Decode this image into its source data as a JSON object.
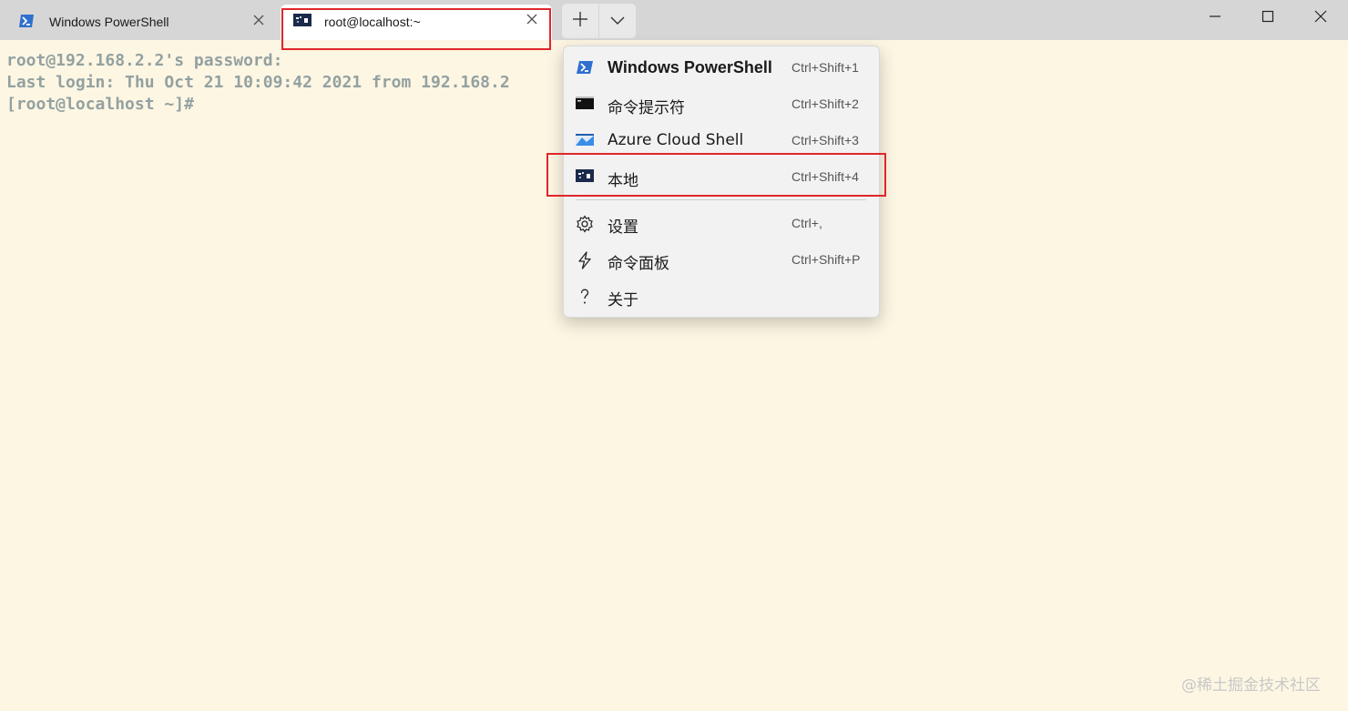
{
  "tabs": [
    {
      "title": "Windows PowerShell",
      "icon": "powershell-icon"
    },
    {
      "title": "root@localhost:~",
      "icon": "linux-terminal-icon",
      "active": true
    }
  ],
  "window_controls": {
    "minimize": "minimize-icon",
    "maximize": "maximize-icon",
    "close": "close-icon"
  },
  "terminal": {
    "lines": [
      "root@192.168.2.2's password:",
      "Last login: Thu Oct 21 10:09:42 2021 from 192.168.2",
      "[root@localhost ~]#"
    ],
    "background": "#fdf6e3",
    "foreground": "#93a1a1"
  },
  "menu": {
    "profiles": [
      {
        "label": "Windows PowerShell",
        "shortcut": "Ctrl+Shift+1",
        "icon": "powershell-icon"
      },
      {
        "label": "命令提示符",
        "shortcut": "Ctrl+Shift+2",
        "icon": "cmd-icon"
      },
      {
        "label": "Azure Cloud Shell",
        "shortcut": "Ctrl+Shift+3",
        "icon": "azure-cloud-icon"
      },
      {
        "label": "本地",
        "shortcut": "Ctrl+Shift+4",
        "icon": "linux-terminal-icon"
      }
    ],
    "actions": [
      {
        "label": "设置",
        "shortcut": "Ctrl+,",
        "icon": "gear-icon"
      },
      {
        "label": "命令面板",
        "shortcut": "Ctrl+Shift+P",
        "icon": "lightning-icon"
      },
      {
        "label": "关于",
        "shortcut": "",
        "icon": "question-icon"
      }
    ]
  },
  "highlight_color": "#e0262a",
  "watermark": "@稀土掘金技术社区"
}
